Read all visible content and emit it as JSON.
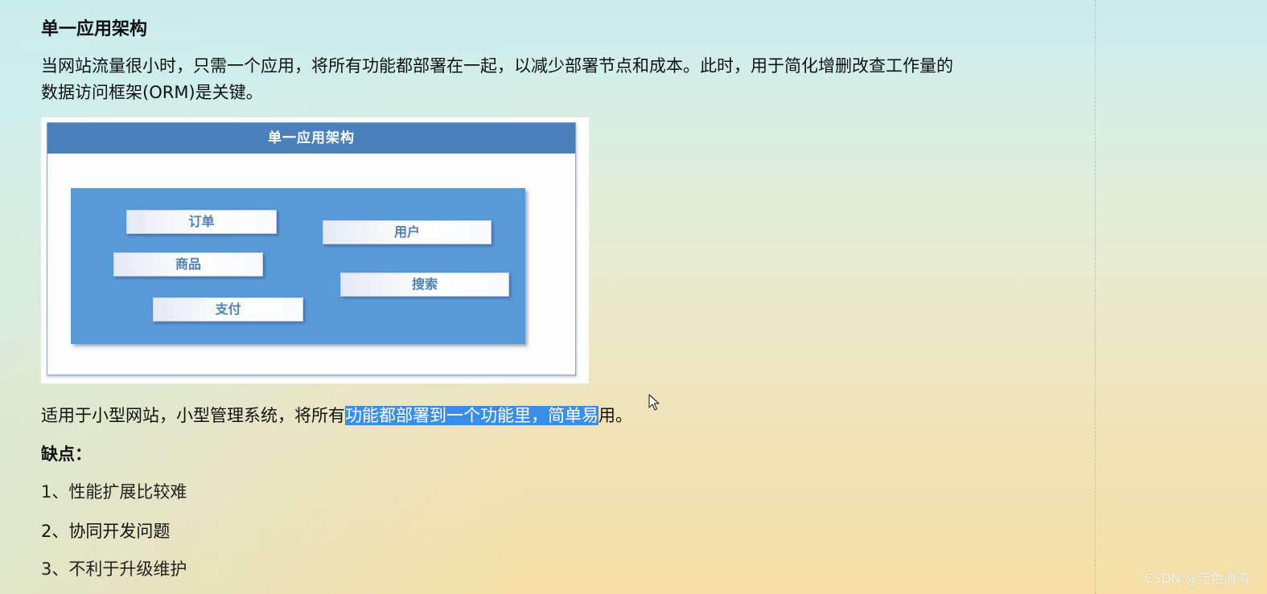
{
  "article": {
    "heading": "单一应用架构",
    "intro_line1": "当网站流量很小时，只需一个应用，将所有功能都部署在一起，以减少部署节点和成本。此时，用于简化增删改查工作量的",
    "intro_line2": "数据访问框架(ORM)是关键。",
    "summary_before": "适用于小型网站，小型管理系统，将所有",
    "summary_selected": "功能都部署到一个功能里，简单易",
    "summary_after": "用。",
    "cons_title": "缺点：",
    "cons": [
      "1、性能扩展比较难",
      "2、协同开发问题",
      "3、不利于升级维护"
    ]
  },
  "figure": {
    "title": "单一应用架构",
    "modules": [
      "订单",
      "用户",
      "商品",
      "搜索",
      "支付"
    ]
  },
  "watermark": "CSDN @茳色海湾",
  "colors": {
    "selection": "#3b8ee8",
    "figure_header": "#4a81bd",
    "figure_panel": "#5899d8",
    "module_text": "#4f7fb6"
  }
}
